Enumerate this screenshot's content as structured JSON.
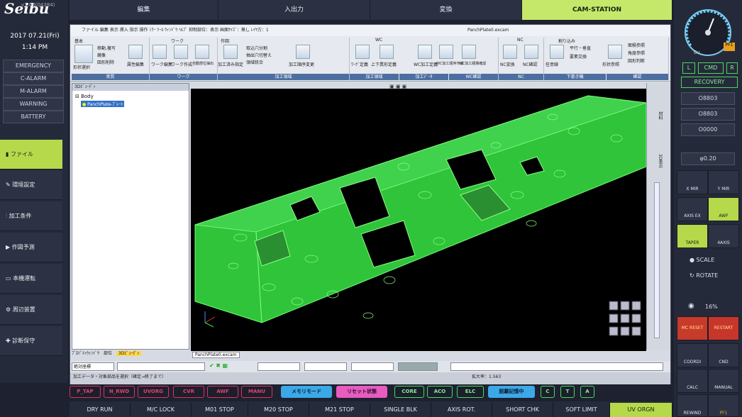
{
  "brand": "Seibu",
  "version": "v1.00(04384)",
  "date": "2017 07.21(Fri)",
  "time": "1:14 PM",
  "alarms": [
    "EMERGENCY",
    "C-ALARM",
    "M-ALARM",
    "WARNING",
    "BATTERY"
  ],
  "nav": [
    "ファイル",
    "環境設定",
    "加工条件",
    "作図予測",
    "本機運転",
    "周辺装置",
    "診断保守"
  ],
  "tabs": [
    "編集",
    "入出力",
    "変換",
    "CAM-STATION"
  ],
  "menubar": "ファイル 編集 表示 挿入 指示 操作 ﾐﾗｰ ﾂｰﾙ ｳｨﾝﾄﾞｳ ﾍﾙﾌﾟ  抑制部位：表示  画面ｻｲｽﾞ：無し  ﾚｲﾔ方：1",
  "file_title": "PanchPlate0.excam",
  "ribbon_groups": [
    "基本",
    "ワーク",
    "作図",
    "WC",
    "NC",
    "割り込み"
  ],
  "ribbon_sub": [
    "実質",
    "ワーク",
    "加工領域",
    "加工領域",
    "加工ﾃﾞｰﾀ",
    "WC確認",
    "NC",
    "下書き機",
    "確認"
  ],
  "ribbon_items": [
    "形状選択",
    "移動,複写",
    "鏡像",
    "図形削除",
    "属性編集",
    "ワーク編集",
    "ワーク作成",
    "自動部位抽出",
    "加工済み指定",
    "取込穴分割",
    "抽出穴切替え",
    "領域統合",
    "加工順序変更",
    "ﾜｰｸﾞ定義",
    "上下異形定義",
    "WC加工定義",
    "WC加工順序作成",
    "WC加工経路確認",
    "NC変換",
    "NC確認",
    "任意線",
    "平行・垂直",
    "要素交換",
    "形状参照",
    "面積参照",
    "角度参照",
    "図形判断"
  ],
  "tree_title": "3Dﾋﾞｭｰﾃﾞｨ",
  "tree_root": "Body",
  "tree_item": "PanchPlate-ﾌﾟﾚｰﾄ",
  "bottom_tabs": [
    "ﾌﾟﾛﾊﾟﾃｨｳｨﾝﾄﾞｳ",
    "部位",
    "3Dﾋﾞｭｰﾃﾞｨ"
  ],
  "doc_tab": "PanchPlate0.excam",
  "cmd_value": "絶対座標",
  "status_text": "加工データ・対象部品を選択（確定→終了まで）",
  "zoom": "拡大率：1.563",
  "side_labels": [
    "材料",
    "3D表示"
  ],
  "right": {
    "gauge_min": "0v",
    "gauge_max": "PF1",
    "btns": [
      "L",
      "CMD",
      "R"
    ],
    "recovery": "RECOVERY",
    "codes": [
      "O8803",
      "O8803",
      "O0000"
    ],
    "phi": "φ0.20",
    "scale": "SCALE",
    "rotate": "ROTATE",
    "percent": "16%"
  },
  "icons": [
    "X MIR",
    "Y MIR",
    "AXIS EX",
    "AWF",
    "TAPER",
    "4AXIS",
    "MC RESET",
    "RESTART",
    "COORDI",
    "CND",
    "CALC",
    "MANUAL",
    "REWIND",
    "PF1"
  ],
  "pills": [
    "P_TAP",
    "N_RWD",
    "UVORG",
    "CVR",
    "AWF",
    "MANU",
    "メモリモード",
    "リセット状態",
    "CORE",
    "ACO",
    "ELC",
    "脱離記憶中",
    "C",
    "T",
    "A"
  ],
  "bottom": [
    "DRY RUN",
    "M/C LOCK",
    "M01 STOP",
    "M20 STOP",
    "M21 STOP",
    "SINGLE BLK",
    "AXIS ROT.",
    "SHORT CHK",
    "SOFT LIMIT",
    "UV ORGN"
  ]
}
